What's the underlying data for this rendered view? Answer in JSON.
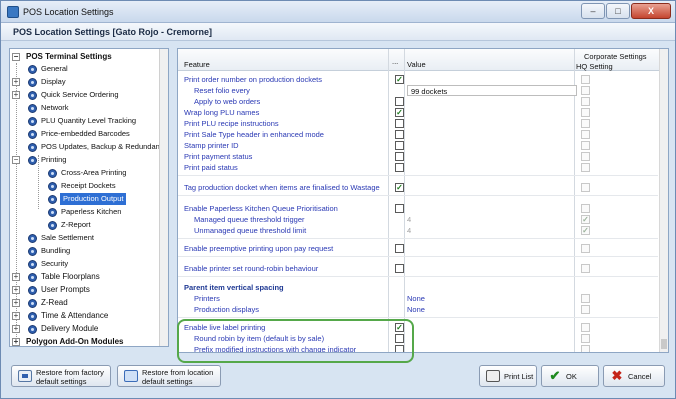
{
  "window": {
    "title": "POS Location Settings",
    "minimize": "–",
    "maximize": "□",
    "close": "X"
  },
  "header": {
    "title": "POS Location Settings  [Gato Rojo - Cremorne]"
  },
  "tree": {
    "items": [
      {
        "label": "POS Terminal Settings",
        "bold": true
      },
      {
        "label": "General"
      },
      {
        "label": "Display"
      },
      {
        "label": "Quick Service Ordering"
      },
      {
        "label": "Network"
      },
      {
        "label": "PLU Quantity Level Tracking"
      },
      {
        "label": "Price-embedded Barcodes"
      },
      {
        "label": "POS Updates, Backup & Redundancy"
      },
      {
        "label": "Printing"
      },
      {
        "label": "Cross-Area Printing"
      },
      {
        "label": "Receipt Dockets"
      },
      {
        "label": "Production Output",
        "selected": true
      },
      {
        "label": "Paperless Kitchen"
      },
      {
        "label": "Z-Report"
      },
      {
        "label": "Sale Settlement"
      },
      {
        "label": "Bundling"
      },
      {
        "label": "Security"
      },
      {
        "label": "Table Floorplans"
      },
      {
        "label": "User Prompts"
      },
      {
        "label": "Z-Read"
      },
      {
        "label": "Time & Attendance"
      },
      {
        "label": "Delivery Module"
      },
      {
        "label": "Polygon Add-On Modules",
        "bold": true
      }
    ]
  },
  "grid": {
    "headers": {
      "feature": "Feature",
      "dots": "...",
      "value": "Value",
      "corporate": "Corporate Settings",
      "hq": "HQ Setting"
    },
    "rows": [
      {
        "feature": "Print order number on production dockets",
        "checked": true
      },
      {
        "feature": "Reset folio every",
        "indent": true,
        "value": "99 dockets",
        "valuebox": true
      },
      {
        "feature": "Apply to web orders",
        "indent": true
      },
      {
        "feature": "Wrap long PLU names",
        "checked": true
      },
      {
        "feature": "Print PLU recipe instructions"
      },
      {
        "feature": "Print Sale Type header in enhanced mode"
      },
      {
        "feature": "Stamp printer ID"
      },
      {
        "feature": "Print payment status"
      },
      {
        "feature": "Print paid status"
      },
      {
        "feature": "Tag production docket when items are finalised to Wastage",
        "checked": true
      },
      {
        "feature": "Enable Paperless Kitchen Queue Prioritisation"
      },
      {
        "feature": "Managed queue threshold trigger",
        "indent": true,
        "value": "4",
        "grey": true
      },
      {
        "feature": "Unmanaged queue threshold limit",
        "indent": true,
        "value": "4",
        "grey": true
      },
      {
        "feature": "Enable preemptive printing upon pay request"
      },
      {
        "feature": "Enable printer set round-robin behaviour"
      },
      {
        "feature": "Parent item vertical spacing",
        "bold": true
      },
      {
        "feature": "Printers",
        "indent": true,
        "value": "None"
      },
      {
        "feature": "Production displays",
        "indent": true,
        "value": "None"
      },
      {
        "feature": "Enable live label printing",
        "checked": true
      },
      {
        "feature": "Round robin by item (default is by sale)",
        "indent": true
      },
      {
        "feature": "Prefix modified instructions with change indicator",
        "indent": true
      }
    ]
  },
  "buttons": {
    "restore_factory": [
      "Restore from factory",
      "default settings"
    ],
    "restore_location": [
      "Restore from location",
      "default settings"
    ],
    "print_list": "Print List",
    "ok": "OK",
    "cancel": "Cancel"
  },
  "icons": {
    "ok": "✔",
    "cancel": "✖",
    "check": "✓"
  }
}
